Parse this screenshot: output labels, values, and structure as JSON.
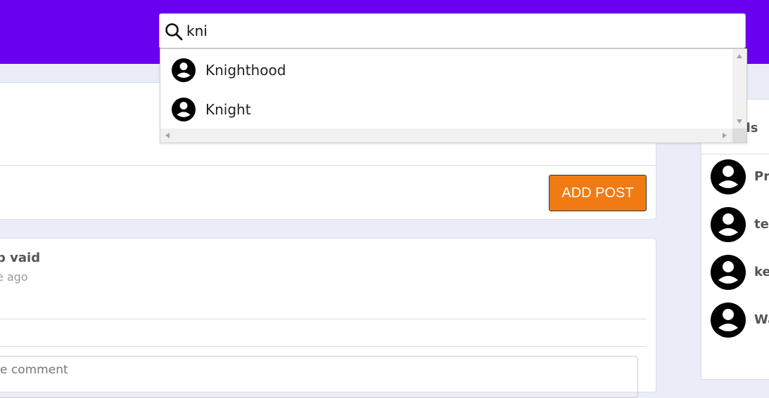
{
  "colors": {
    "topbar": "#6a00f0",
    "accent_button": "#f07b14",
    "page_bg": "#eaecf7"
  },
  "search": {
    "value": "kni",
    "placeholder": ""
  },
  "suggestions": [
    {
      "label": "Knighthood",
      "icon": "user-avatar-icon"
    },
    {
      "label": "Knight",
      "icon": "user-avatar-icon"
    }
  ],
  "composer": {
    "add_post_label": "ADD POST"
  },
  "post": {
    "author": "p vaid",
    "time": "e ago",
    "comment_placeholder": "e comment"
  },
  "friends": {
    "title": "nds",
    "items": [
      {
        "name": "Pr"
      },
      {
        "name": "tes"
      },
      {
        "name": "ke"
      },
      {
        "name": "Wa"
      }
    ]
  }
}
